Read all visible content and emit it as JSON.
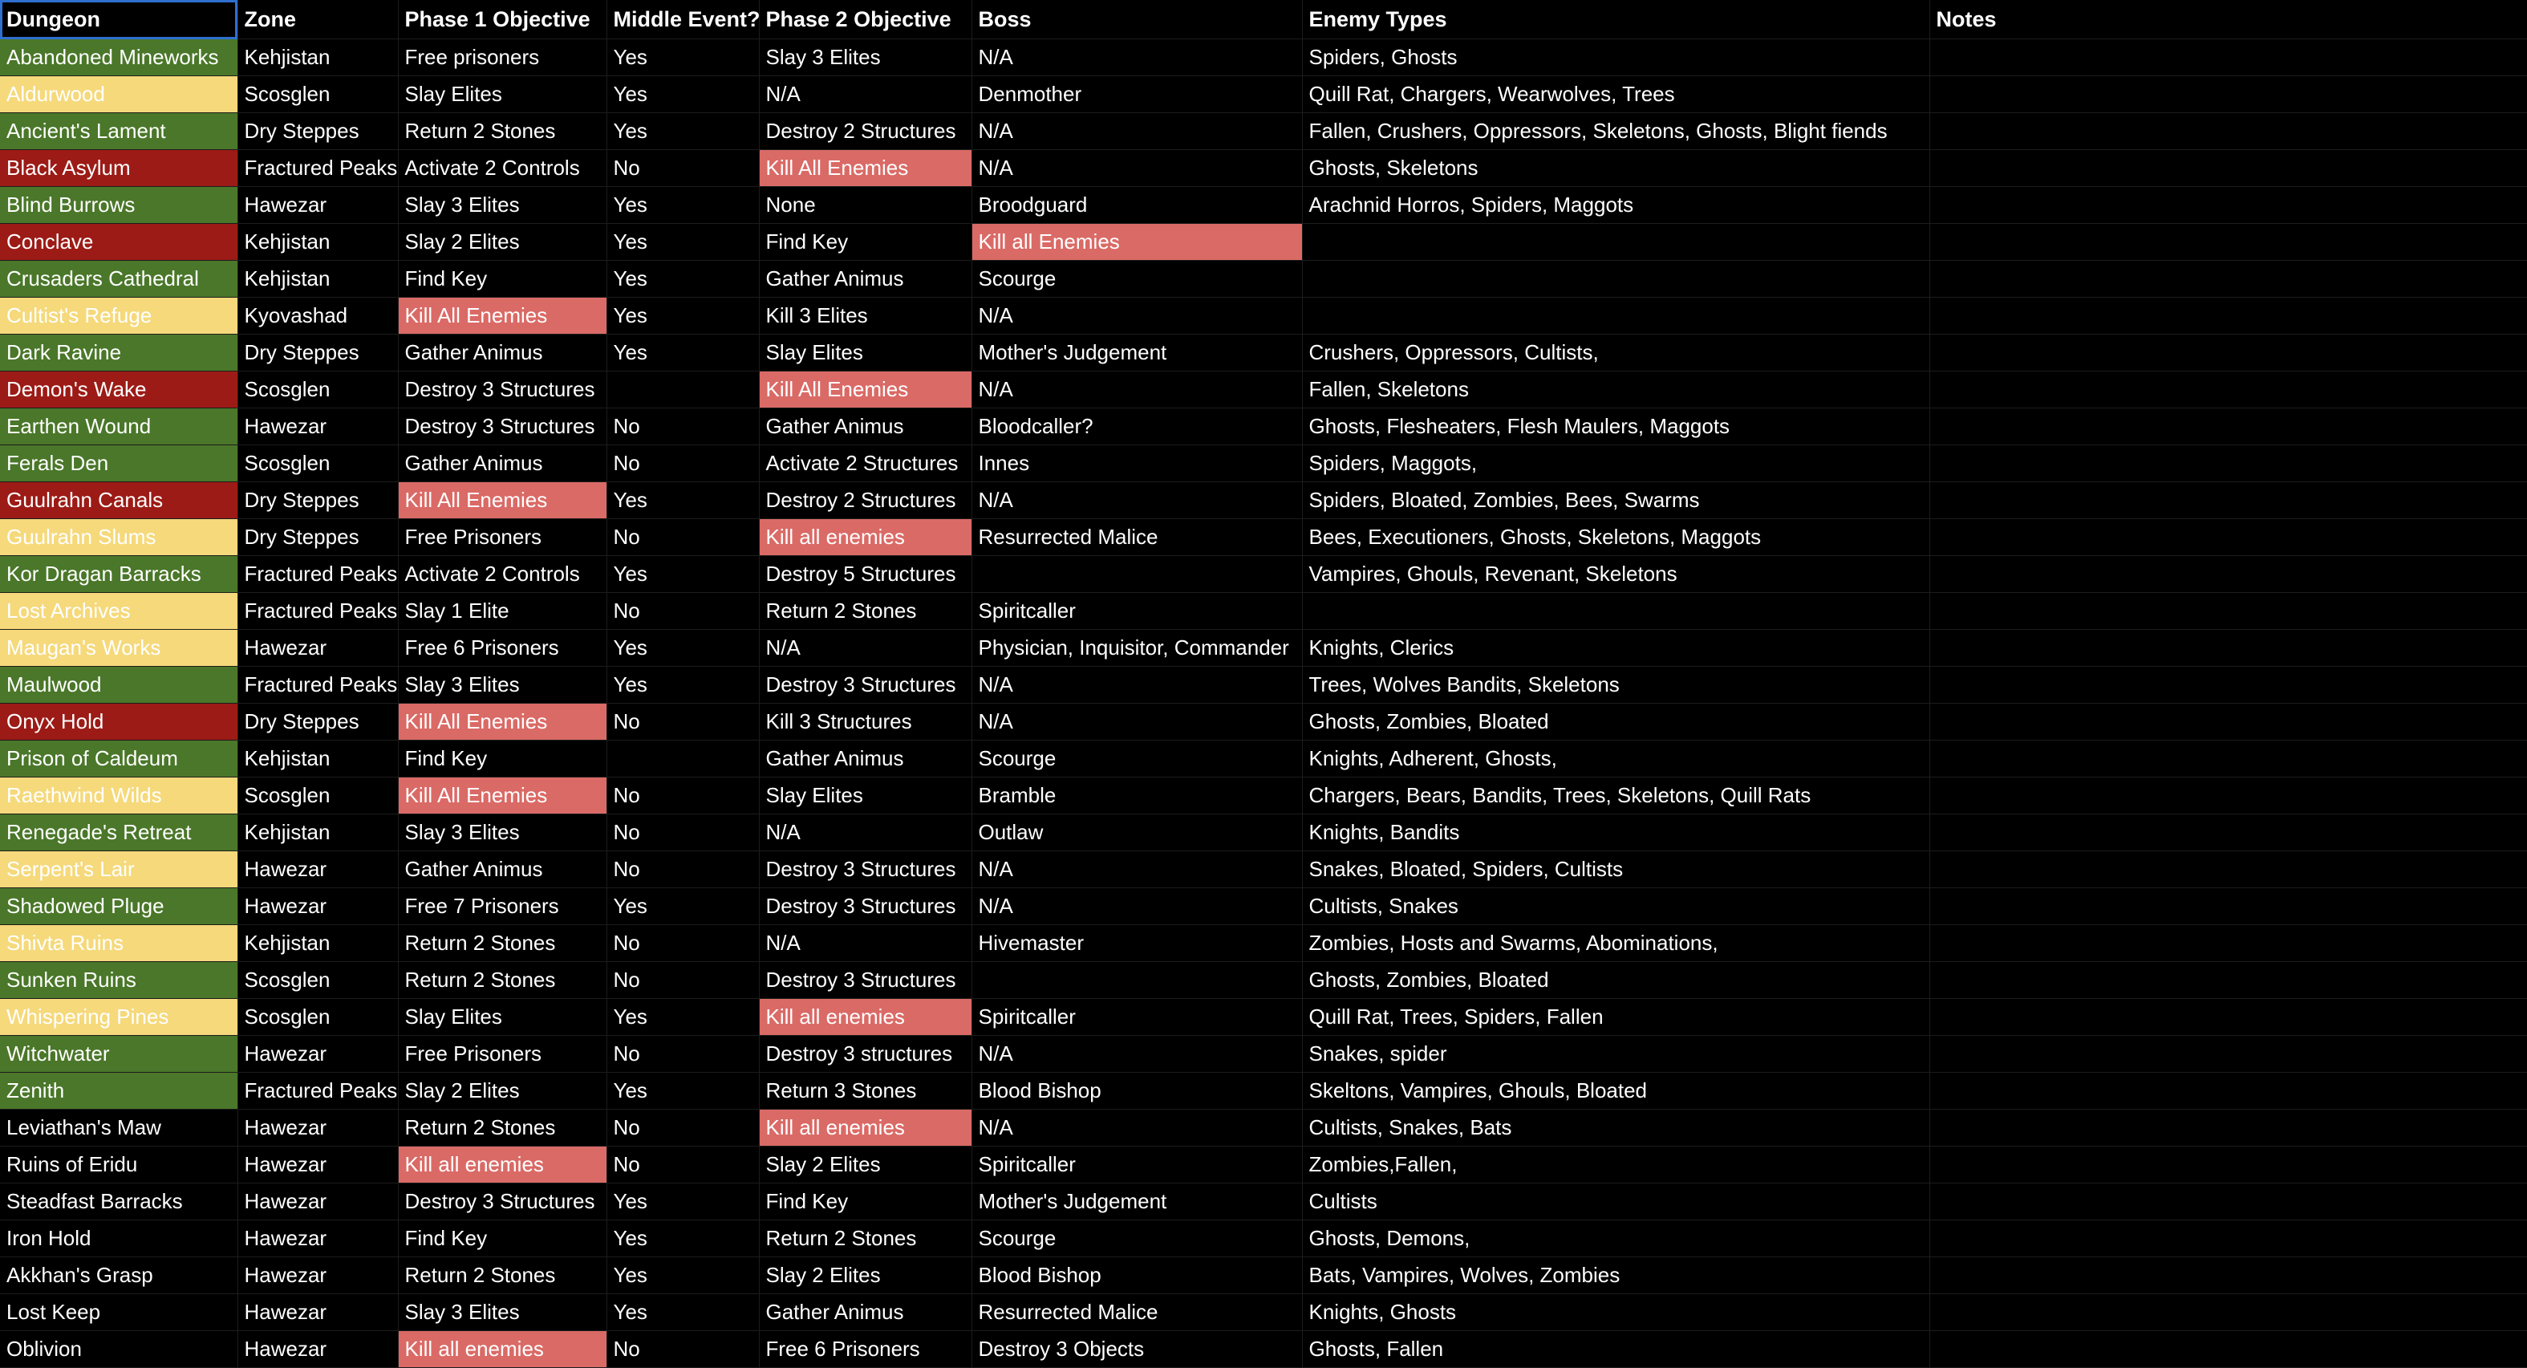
{
  "colors": {
    "background": "#000000",
    "grid_line": "#1c1c1c",
    "text": "#ffffff",
    "fill_green": "#4a7729",
    "fill_yellow": "#f5d97b",
    "fill_dark_red": "#9c1b16",
    "fill_salmon": "#da6a66",
    "selection_border": "#2f6fd0"
  },
  "headers": {
    "dungeon": "Dungeon",
    "zone": "Zone",
    "phase1": "Phase 1 Objective",
    "middle": "Middle Event?",
    "phase2": "Phase 2 Objective",
    "boss": "Boss",
    "enemies": "Enemy Types",
    "notes": "Notes"
  },
  "rows": [
    {
      "dungeon": "Abandoned Mineworks",
      "dungeon_fill": "green",
      "zone": "Kehjistan",
      "phase1": "Free prisoners",
      "phase1_fill": "none",
      "middle": "Yes",
      "phase2": "Slay 3 Elites",
      "phase2_fill": "none",
      "boss": "N/A",
      "boss_fill": "none",
      "enemies": "Spiders, Ghosts",
      "notes": ""
    },
    {
      "dungeon": "Aldurwood",
      "dungeon_fill": "yellow",
      "zone": "Scosglen",
      "phase1": "Slay Elites",
      "phase1_fill": "none",
      "middle": "Yes",
      "phase2": "N/A",
      "phase2_fill": "none",
      "boss": "Denmother",
      "boss_fill": "none",
      "enemies": "Quill Rat, Chargers, Wearwolves, Trees",
      "notes": ""
    },
    {
      "dungeon": "Ancient's Lament",
      "dungeon_fill": "green",
      "zone": "Dry Steppes",
      "phase1": "Return 2 Stones",
      "phase1_fill": "none",
      "middle": "Yes",
      "phase2": "Destroy 2 Structures",
      "phase2_fill": "none",
      "boss": "N/A",
      "boss_fill": "none",
      "enemies": "Fallen, Crushers, Oppressors, Skeletons, Ghosts, Blight fiends",
      "notes": ""
    },
    {
      "dungeon": "Black Asylum",
      "dungeon_fill": "dark-red",
      "zone": "Fractured Peaks",
      "phase1": "Activate 2 Controls",
      "phase1_fill": "none",
      "middle": "No",
      "phase2": "Kill All Enemies",
      "phase2_fill": "salmon",
      "boss": "N/A",
      "boss_fill": "none",
      "enemies": "Ghosts, Skeletons",
      "notes": ""
    },
    {
      "dungeon": "Blind Burrows",
      "dungeon_fill": "green",
      "zone": "Hawezar",
      "phase1": "Slay 3 Elites",
      "phase1_fill": "none",
      "middle": "Yes",
      "phase2": "None",
      "phase2_fill": "none",
      "boss": "Broodguard",
      "boss_fill": "none",
      "enemies": "Arachnid Horros, Spiders, Maggots",
      "notes": ""
    },
    {
      "dungeon": "Conclave",
      "dungeon_fill": "dark-red",
      "zone": "Kehjistan",
      "phase1": "Slay 2 Elites",
      "phase1_fill": "none",
      "middle": "Yes",
      "phase2": "Find Key",
      "phase2_fill": "none",
      "boss": "Kill all Enemies",
      "boss_fill": "salmon",
      "enemies": "",
      "notes": ""
    },
    {
      "dungeon": "Crusaders Cathedral",
      "dungeon_fill": "green",
      "zone": "Kehjistan",
      "phase1": "Find Key",
      "phase1_fill": "none",
      "middle": "Yes",
      "phase2": "Gather Animus",
      "phase2_fill": "none",
      "boss": "Scourge",
      "boss_fill": "none",
      "enemies": "",
      "notes": ""
    },
    {
      "dungeon": "Cultist's Refuge",
      "dungeon_fill": "yellow",
      "zone": "Kyovashad",
      "phase1": "Kill All Enemies",
      "phase1_fill": "salmon",
      "middle": "Yes",
      "phase2": "Kill 3 Elites",
      "phase2_fill": "none",
      "boss": "N/A",
      "boss_fill": "none",
      "enemies": "",
      "notes": ""
    },
    {
      "dungeon": "Dark Ravine",
      "dungeon_fill": "green",
      "zone": "Dry Steppes",
      "phase1": "Gather Animus",
      "phase1_fill": "none",
      "middle": "Yes",
      "phase2": "Slay Elites",
      "phase2_fill": "none",
      "boss": "Mother's Judgement",
      "boss_fill": "none",
      "enemies": "Crushers, Oppressors, Cultists,",
      "notes": ""
    },
    {
      "dungeon": "Demon's Wake",
      "dungeon_fill": "dark-red",
      "zone": "Scosglen",
      "phase1": "Destroy 3 Structures",
      "phase1_fill": "none",
      "middle": "",
      "phase2": "Kill All Enemies",
      "phase2_fill": "salmon",
      "boss": "N/A",
      "boss_fill": "none",
      "enemies": "Fallen, Skeletons",
      "notes": ""
    },
    {
      "dungeon": "Earthen Wound",
      "dungeon_fill": "green",
      "zone": "Hawezar",
      "phase1": "Destroy 3 Structures",
      "phase1_fill": "none",
      "middle": "No",
      "phase2": "Gather Animus",
      "phase2_fill": "none",
      "boss": "Bloodcaller?",
      "boss_fill": "none",
      "enemies": "Ghosts, Flesheaters, Flesh Maulers, Maggots",
      "notes": ""
    },
    {
      "dungeon": "Ferals Den",
      "dungeon_fill": "green",
      "zone": "Scosglen",
      "phase1": "Gather Animus",
      "phase1_fill": "none",
      "middle": "No",
      "phase2": "Activate 2 Structures",
      "phase2_fill": "none",
      "boss": "Innes",
      "boss_fill": "none",
      "enemies": "Spiders, Maggots,",
      "notes": ""
    },
    {
      "dungeon": "Guulrahn Canals",
      "dungeon_fill": "dark-red",
      "zone": "Dry Steppes",
      "phase1": "Kill All Enemies",
      "phase1_fill": "salmon",
      "middle": "Yes",
      "phase2": "Destroy 2 Structures",
      "phase2_fill": "none",
      "boss": "N/A",
      "boss_fill": "none",
      "enemies": "Spiders, Bloated, Zombies, Bees, Swarms",
      "notes": ""
    },
    {
      "dungeon": "Guulrahn Slums",
      "dungeon_fill": "yellow",
      "zone": "Dry Steppes",
      "phase1": "Free Prisoners",
      "phase1_fill": "none",
      "middle": "No",
      "phase2": "Kill all enemies",
      "phase2_fill": "salmon",
      "boss": "Resurrected Malice",
      "boss_fill": "none",
      "enemies": "Bees,  Executioners, Ghosts, Skeletons, Maggots",
      "notes": ""
    },
    {
      "dungeon": "Kor Dragan Barracks",
      "dungeon_fill": "green",
      "zone": "Fractured Peaks",
      "phase1": "Activate 2 Controls",
      "phase1_fill": "none",
      "middle": "Yes",
      "phase2": "Destroy 5 Structures",
      "phase2_fill": "none",
      "boss": "",
      "boss_fill": "none",
      "enemies": "Vampires, Ghouls, Revenant, Skeletons",
      "notes": ""
    },
    {
      "dungeon": "Lost Archives",
      "dungeon_fill": "yellow",
      "zone": "Fractured Peaks",
      "phase1": "Slay 1 Elite",
      "phase1_fill": "none",
      "middle": "No",
      "phase2": "Return 2 Stones",
      "phase2_fill": "none",
      "boss": "Spiritcaller",
      "boss_fill": "none",
      "enemies": "",
      "notes": ""
    },
    {
      "dungeon": "Maugan's Works",
      "dungeon_fill": "yellow",
      "zone": "Hawezar",
      "phase1": "Free 6 Prisoners",
      "phase1_fill": "none",
      "middle": "Yes",
      "phase2": "N/A",
      "phase2_fill": "none",
      "boss": "Physician, Inquisitor, Commander",
      "boss_fill": "none",
      "enemies": "Knights, Clerics",
      "notes": ""
    },
    {
      "dungeon": "Maulwood",
      "dungeon_fill": "green",
      "zone": "Fractured Peaks",
      "phase1": "Slay 3 Elites",
      "phase1_fill": "none",
      "middle": "Yes",
      "phase2": "Destroy 3 Structures",
      "phase2_fill": "none",
      "boss": "N/A",
      "boss_fill": "none",
      "enemies": "Trees, Wolves Bandits, Skeletons",
      "notes": ""
    },
    {
      "dungeon": "Onyx Hold",
      "dungeon_fill": "dark-red",
      "zone": "Dry Steppes",
      "phase1": "Kill All Enemies",
      "phase1_fill": "salmon",
      "middle": "No",
      "phase2": "Kill 3 Structures",
      "phase2_fill": "none",
      "boss": "N/A",
      "boss_fill": "none",
      "enemies": "Ghosts, Zombies, Bloated",
      "notes": ""
    },
    {
      "dungeon": "Prison of Caldeum",
      "dungeon_fill": "green",
      "zone": "Kehjistan",
      "phase1": "Find Key",
      "phase1_fill": "none",
      "middle": "",
      "phase2": "Gather Animus",
      "phase2_fill": "none",
      "boss": "Scourge",
      "boss_fill": "none",
      "enemies": "Knights, Adherent, Ghosts,",
      "notes": ""
    },
    {
      "dungeon": "Raethwind Wilds",
      "dungeon_fill": "yellow",
      "zone": "Scosglen",
      "phase1": "Kill All Enemies",
      "phase1_fill": "salmon",
      "middle": "No",
      "phase2": "Slay Elites",
      "phase2_fill": "none",
      "boss": "Bramble",
      "boss_fill": "none",
      "enemies": "Chargers, Bears, Bandits, Trees, Skeletons, Quill Rats",
      "notes": ""
    },
    {
      "dungeon": "Renegade's Retreat",
      "dungeon_fill": "green",
      "zone": "Kehjistan",
      "phase1": "Slay 3 Elites",
      "phase1_fill": "none",
      "middle": "No",
      "phase2": "N/A",
      "phase2_fill": "none",
      "boss": "Outlaw",
      "boss_fill": "none",
      "enemies": "Knights, Bandits",
      "notes": ""
    },
    {
      "dungeon": "Serpent's Lair",
      "dungeon_fill": "yellow",
      "zone": "Hawezar",
      "phase1": "Gather Animus",
      "phase1_fill": "none",
      "middle": "No",
      "phase2": "Destroy 3 Structures",
      "phase2_fill": "none",
      "boss": "N/A",
      "boss_fill": "none",
      "enemies": "Snakes, Bloated, Spiders, Cultists",
      "notes": ""
    },
    {
      "dungeon": "Shadowed Pluge",
      "dungeon_fill": "green",
      "zone": "Hawezar",
      "phase1": "Free 7 Prisoners",
      "phase1_fill": "none",
      "middle": "Yes",
      "phase2": "Destroy 3 Structures",
      "phase2_fill": "none",
      "boss": "N/A",
      "boss_fill": "none",
      "enemies": "Cultists, Snakes",
      "notes": ""
    },
    {
      "dungeon": "Shivta Ruins",
      "dungeon_fill": "yellow",
      "zone": "Kehjistan",
      "phase1": "Return 2 Stones",
      "phase1_fill": "none",
      "middle": "No",
      "phase2": "N/A",
      "phase2_fill": "none",
      "boss": "Hivemaster",
      "boss_fill": "none",
      "enemies": "Zombies, Hosts and Swarms, Abominations,",
      "notes": ""
    },
    {
      "dungeon": "Sunken Ruins",
      "dungeon_fill": "green",
      "zone": "Scosglen",
      "phase1": "Return 2 Stones",
      "phase1_fill": "none",
      "middle": "No",
      "phase2": "Destroy 3 Structures",
      "phase2_fill": "none",
      "boss": "",
      "boss_fill": "none",
      "enemies": "Ghosts, Zombies, Bloated",
      "notes": ""
    },
    {
      "dungeon": "Whispering Pines",
      "dungeon_fill": "yellow",
      "zone": "Scosglen",
      "phase1": "Slay Elites",
      "phase1_fill": "none",
      "middle": "Yes",
      "phase2": "Kill all enemies",
      "phase2_fill": "salmon",
      "boss": "Spiritcaller",
      "boss_fill": "none",
      "enemies": "Quill Rat, Trees, Spiders, Fallen",
      "notes": ""
    },
    {
      "dungeon": "Witchwater",
      "dungeon_fill": "green",
      "zone": "Hawezar",
      "phase1": "Free Prisoners",
      "phase1_fill": "none",
      "middle": "No",
      "phase2": "Destroy 3 structures",
      "phase2_fill": "none",
      "boss": "N/A",
      "boss_fill": "none",
      "enemies": "Snakes, spider",
      "notes": ""
    },
    {
      "dungeon": "Zenith",
      "dungeon_fill": "green",
      "zone": "Fractured Peaks",
      "phase1": "Slay 2 Elites",
      "phase1_fill": "none",
      "middle": "Yes",
      "phase2": "Return 3 Stones",
      "phase2_fill": "none",
      "boss": "Blood Bishop",
      "boss_fill": "none",
      "enemies": "Skeltons, Vampires, Ghouls, Bloated",
      "notes": ""
    },
    {
      "dungeon": "Leviathan's Maw",
      "dungeon_fill": "none",
      "zone": "Hawezar",
      "phase1": "Return 2 Stones",
      "phase1_fill": "none",
      "middle": "No",
      "phase2": "Kill all enemies",
      "phase2_fill": "salmon",
      "boss": "N/A",
      "boss_fill": "none",
      "enemies": "Cultists, Snakes, Bats",
      "notes": ""
    },
    {
      "dungeon": "Ruins of Eridu",
      "dungeon_fill": "none",
      "zone": "Hawezar",
      "phase1": "Kill all enemies",
      "phase1_fill": "salmon",
      "middle": "No",
      "phase2": "Slay 2 Elites",
      "phase2_fill": "none",
      "boss": "Spiritcaller",
      "boss_fill": "none",
      "enemies": "Zombies,Fallen,",
      "notes": ""
    },
    {
      "dungeon": "Steadfast Barracks",
      "dungeon_fill": "none",
      "zone": "Hawezar",
      "phase1": "Destroy 3 Structures",
      "phase1_fill": "none",
      "middle": "Yes",
      "phase2": "Find Key",
      "phase2_fill": "none",
      "boss": "Mother's Judgement",
      "boss_fill": "none",
      "enemies": "Cultists",
      "notes": ""
    },
    {
      "dungeon": "Iron Hold",
      "dungeon_fill": "none",
      "zone": "Hawezar",
      "phase1": "Find Key",
      "phase1_fill": "none",
      "middle": "Yes",
      "phase2": "Return 2 Stones",
      "phase2_fill": "none",
      "boss": "Scourge",
      "boss_fill": "none",
      "enemies": "Ghosts, Demons,",
      "notes": ""
    },
    {
      "dungeon": "Akkhan's Grasp",
      "dungeon_fill": "none",
      "zone": "Hawezar",
      "phase1": "Return 2 Stones",
      "phase1_fill": "none",
      "middle": "Yes",
      "phase2": "Slay 2 Elites",
      "phase2_fill": "none",
      "boss": "Blood Bishop",
      "boss_fill": "none",
      "enemies": "Bats, Vampires, Wolves, Zombies",
      "notes": ""
    },
    {
      "dungeon": "Lost Keep",
      "dungeon_fill": "none",
      "zone": "Hawezar",
      "phase1": "Slay 3 Elites",
      "phase1_fill": "none",
      "middle": "Yes",
      "phase2": "Gather Animus",
      "phase2_fill": "none",
      "boss": "Resurrected Malice",
      "boss_fill": "none",
      "enemies": "Knights, Ghosts",
      "notes": ""
    },
    {
      "dungeon": "Oblivion",
      "dungeon_fill": "none",
      "zone": "Hawezar",
      "phase1": "Kill all enemies",
      "phase1_fill": "salmon",
      "middle": "No",
      "phase2": "Free 6 Prisoners",
      "phase2_fill": "none",
      "boss": "Destroy 3 Objects",
      "boss_fill": "none",
      "enemies": "Ghosts, Fallen",
      "notes": ""
    }
  ]
}
